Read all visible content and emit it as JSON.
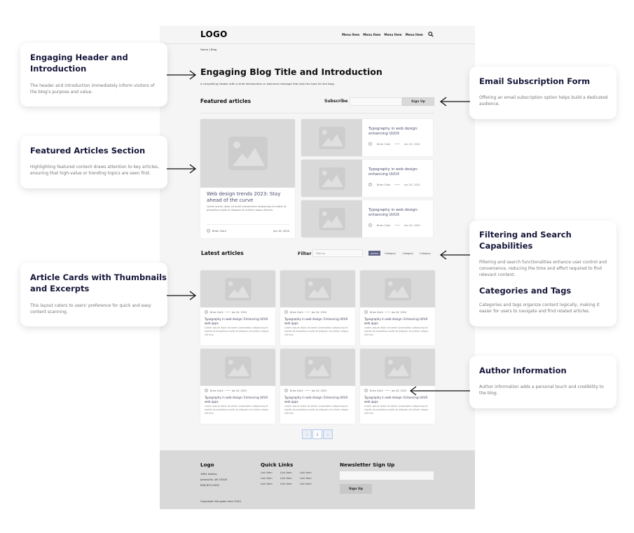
{
  "nav": {
    "logo": "LOGO",
    "menu": [
      "Menu Item",
      "Menu Item",
      "Menu Item",
      "Menu Item"
    ],
    "search_icon": "search-icon"
  },
  "breadcrumb": "Home | Blog",
  "hero": {
    "title": "Engaging Blog Title and Introduction",
    "intro": "A compelling header with a brief introduction or welcome message that sets the tone for the blog."
  },
  "featured": {
    "title": "Featured articles",
    "subscribe_label": "Subscribe",
    "subscribe_placeholder": "",
    "signup_button": "Sign Up",
    "main": {
      "title": "Web design trends 2023: Stay ahead of the curve",
      "excerpt": "Lorem ipsum dolor sit amet consectetur adipiscing et mattis at phasellus mollis at aliquam at nullam neque ultrices.",
      "author": "Brian Clark",
      "date": "Jan 16, 2024"
    },
    "side": [
      {
        "title": "Typography in web design: enhancing UI/UX",
        "author": "Brian Clark",
        "date": "Jan 24, 2024"
      },
      {
        "title": "Typography in web design: enhancing UI/UX",
        "author": "Brian Clark",
        "date": "Jan 24, 2024"
      },
      {
        "title": "Typography in web design: enhancing UI/UX",
        "author": "Brian Clark",
        "date": "Jan 24, 2024"
      }
    ]
  },
  "latest": {
    "title": "Latest articles",
    "filter_label": "Filter",
    "filter_placeholder": "Filter by",
    "chips": [
      {
        "label": "Active",
        "active": true
      },
      {
        "label": "Category",
        "active": false
      },
      {
        "label": "Category",
        "active": false
      },
      {
        "label": "Category",
        "active": false
      }
    ],
    "articles": [
      {
        "author": "Brian Clark",
        "date": "Jan 24, 2024",
        "title": "Typography in web design: Enhancing UI/UX web apps",
        "excerpt": "Lorem ipsum dolor sit amet consectetur adipiscing et mattis at phasellus mollis at aliquam at nullam neque ultrices."
      },
      {
        "author": "Brian Clark",
        "date": "Jan 24, 2024",
        "title": "Typography in web design: Enhancing UI/UX web apps",
        "excerpt": "Lorem ipsum dolor sit amet consectetur adipiscing et mattis at phasellus mollis at aliquam at nullam neque ultrices."
      },
      {
        "author": "Brian Clark",
        "date": "Jan 24, 2024",
        "title": "Typography in web design: Enhancing UI/UX web apps",
        "excerpt": "Lorem ipsum dolor sit amet consectetur adipiscing et mattis at phasellus mollis at aliquam at nullam neque ultrices."
      },
      {
        "author": "Brian Clark",
        "date": "Jan 24, 2024",
        "title": "Typography in web design: Enhancing UI/UX web apps",
        "excerpt": "Lorem ipsum dolor sit amet consectetur adipiscing et mattis at phasellus mollis at aliquam at nullam neque ultrices."
      },
      {
        "author": "Brian Clark",
        "date": "Jan 24, 2024",
        "title": "Typography in web design: Enhancing UI/UX web apps",
        "excerpt": "Lorem ipsum dolor sit amet consectetur adipiscing et mattis at phasellus mollis at aliquam at nullam neque ultrices."
      },
      {
        "author": "Brian Clark",
        "date": "Jan 24, 2024",
        "title": "Typography in web design: Enhancing UI/UX web apps",
        "excerpt": "Lorem ipsum dolor sit amet consectetur adipiscing et mattis at phasellus mollis at aliquam at nullam neque ultrices."
      }
    ]
  },
  "pagination": {
    "prev": "‹",
    "current": "1",
    "next": "›"
  },
  "footer": {
    "logo": "Logo",
    "address": [
      "1691 Adress",
      "Janesville, WI 53545",
      "608-833-0000"
    ],
    "copyright": "Copyright info goes here 2024.",
    "quick_links_title": "Quick Links",
    "links": [
      "Link Item",
      "Link Item",
      "Link Item",
      "Link Item",
      "Link Item",
      "Link Item",
      "Link Item",
      "Link Item",
      "Link Item"
    ],
    "newsletter_title": "Newsletter Sign Up",
    "newsletter_placeholder": "",
    "newsletter_button": "Sign Up"
  },
  "annotations": [
    {
      "title": "Engaging Header and Introduction",
      "text": "The header and introduction immediately inform visitors of the blog's purpose and value."
    },
    {
      "title": "Featured Articles Section",
      "text": "Highlighting featured content draws attention to key articles, ensuring that high-value or trending topics are seen first."
    },
    {
      "title": "Article Cards with Thumbnails and Excerpts",
      "text": "This layout caters to users' preference for quick and easy content scanning."
    },
    {
      "title": "Email Subscription Form",
      "text": "Offering an email subscription option helps build a dedicated audience."
    },
    {
      "title": "Filtering and Search Capabilities",
      "text": "Filtering and search functionalities enhance user control and convenience, reducing the time and effort required to find relevant content."
    },
    {
      "title": "Categories and Tags",
      "text": "Categories and tags organize content logically, making it easier for users to navigate and find related articles."
    },
    {
      "title": "Author Information",
      "text": "Author information adds a personal touch and credibility to the blog."
    }
  ],
  "colors": {
    "accent": "#5d6183",
    "title_text": "#16163a",
    "placeholder_gray": "#d9d9d9",
    "footer_bg": "#d9d9d9",
    "page_bg": "#f5f5f5"
  }
}
